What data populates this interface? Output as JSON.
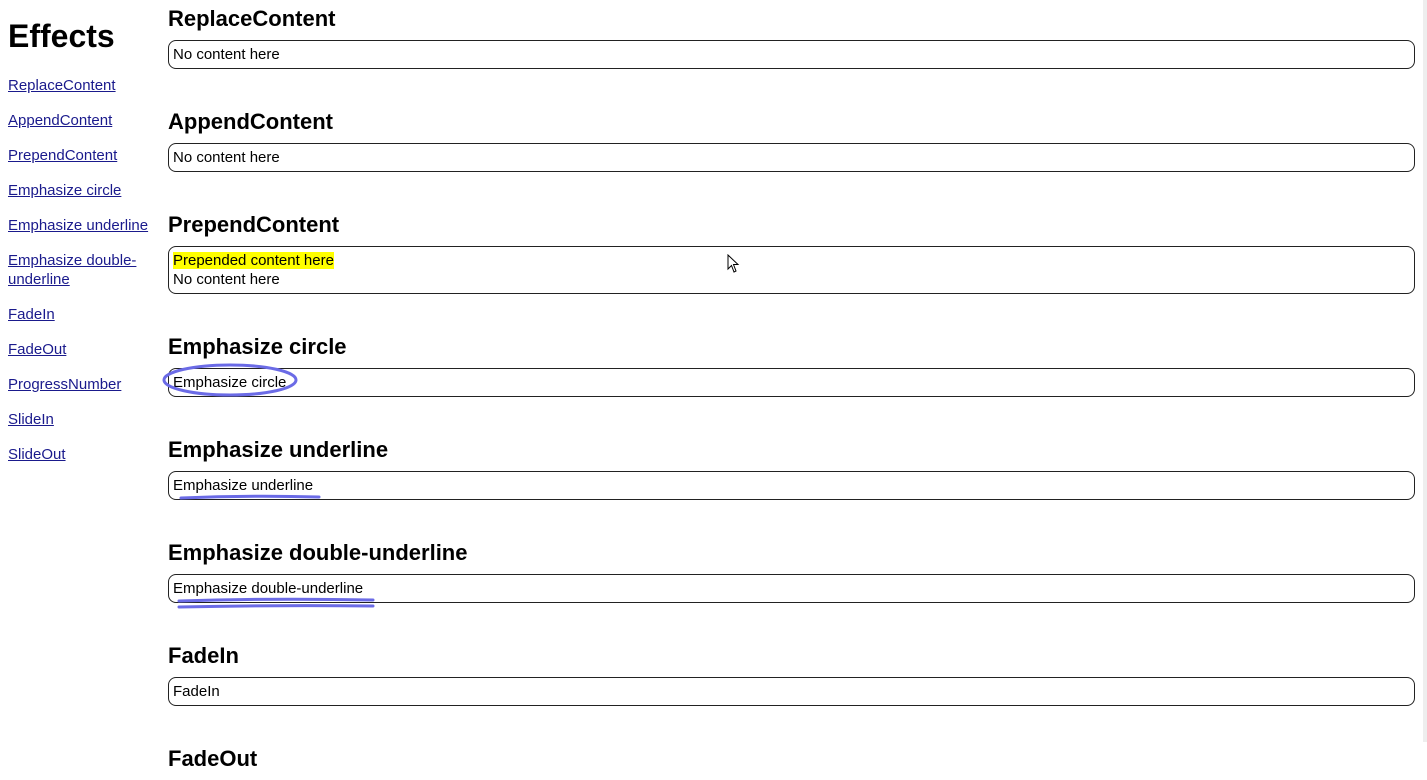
{
  "sidebar": {
    "title": "Effects",
    "items": [
      {
        "label": "ReplaceContent"
      },
      {
        "label": "AppendContent"
      },
      {
        "label": "PrependContent"
      },
      {
        "label": "Emphasize circle"
      },
      {
        "label": "Emphasize underline"
      },
      {
        "label": "Emphasize double-underline"
      },
      {
        "label": "FadeIn"
      },
      {
        "label": "FadeOut"
      },
      {
        "label": "ProgressNumber"
      },
      {
        "label": "SlideIn"
      },
      {
        "label": "SlideOut"
      }
    ]
  },
  "sections": {
    "replace": {
      "title": "ReplaceContent",
      "content": "No content here"
    },
    "append": {
      "title": "AppendContent",
      "content": "No content here"
    },
    "prepend": {
      "title": "PrependContent",
      "prepended": "Prepended content here",
      "content": "No content here"
    },
    "circle": {
      "title": "Emphasize circle",
      "content": "Emphasize circle"
    },
    "underline": {
      "title": "Emphasize underline",
      "content": "Emphasize underline"
    },
    "double": {
      "title": "Emphasize double-underline",
      "content": "Emphasize double-underline"
    },
    "fadein": {
      "title": "FadeIn",
      "content": "FadeIn"
    },
    "fadeout": {
      "title": "FadeOut"
    }
  },
  "colors": {
    "link": "#1a1a8c",
    "highlight": "#ffff00",
    "emphasis_stroke": "#6b6be6"
  }
}
